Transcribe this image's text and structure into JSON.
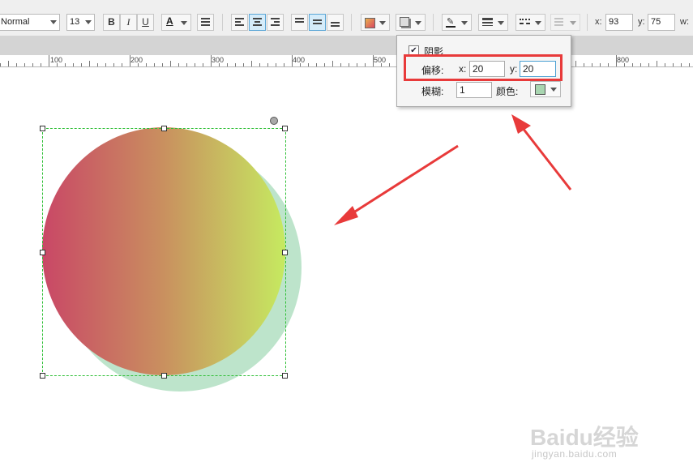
{
  "toolbar": {
    "style_value": "Normal",
    "font_size": "13",
    "bold_label": "B",
    "italic_label": "I",
    "underline_label": "U",
    "text_color_label": "A",
    "x_label": "x:",
    "x_value": "93",
    "y_label": "y:",
    "y_value": "75",
    "w_label": "w:"
  },
  "ruler": {
    "labels": [
      "100",
      "200",
      "300",
      "400",
      "500",
      "800"
    ]
  },
  "shadow_popup": {
    "shadow_label": "阴影",
    "shadow_checked": true,
    "offset_label": "偏移:",
    "offset_x_label": "x:",
    "offset_x_value": "20",
    "offset_y_label": "y:",
    "offset_y_value": "20",
    "blur_label": "模糊:",
    "blur_value": "1",
    "color_label": "颜色:",
    "shadow_color": "#a8d5b0"
  },
  "colors": {
    "gradient_start": "#c94766",
    "gradient_end": "#c6ea60",
    "shadow_fill": "#95d4ab",
    "selection": "#2fbf36",
    "annotation": "#e83a3a"
  },
  "watermark": {
    "brand": "Baidu经验",
    "url": "jingyan.baidu.com"
  }
}
